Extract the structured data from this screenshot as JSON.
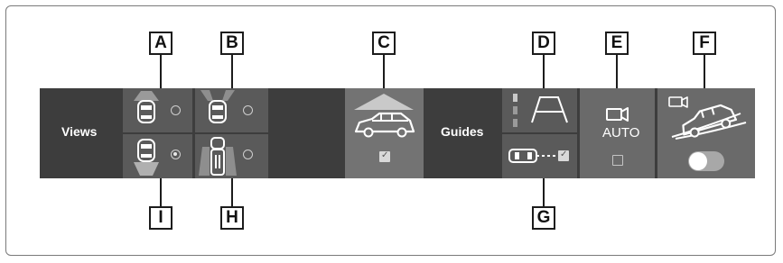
{
  "strip": {
    "views_label": "Views",
    "guides_label": "Guides",
    "auto_label": "AUTO"
  },
  "callouts": {
    "a": "A",
    "b": "B",
    "c": "C",
    "d": "D",
    "e": "E",
    "f": "F",
    "g": "G",
    "h": "H",
    "i": "I"
  },
  "icons": {
    "view_a": "car-top-front-sensor-icon",
    "view_b": "car-top-front-corners-icon",
    "view_i": "car-top-rear-sensor-icon",
    "view_h": "car-top-side-view-icon",
    "panel_c": "car-side-front-range-icon",
    "guide_d": "parking-guide-lines-icon",
    "guide_g": "car-top-dashed-guide-icon",
    "camera_e": "camera-icon",
    "camera_f": "camera-icon",
    "offroad_f": "car-offroad-slope-icon"
  },
  "states": {
    "view_a_selected": false,
    "view_b_selected": false,
    "view_i_selected": true,
    "view_h_selected": false,
    "panel_c_checked": true,
    "guide_g_checked": true,
    "auto_checked": false,
    "toggle_f_on": false
  },
  "colors": {
    "strip_background": "#3d3d3d",
    "button_background": "#5a5a5a",
    "callout_border": "#1c1c1c"
  }
}
